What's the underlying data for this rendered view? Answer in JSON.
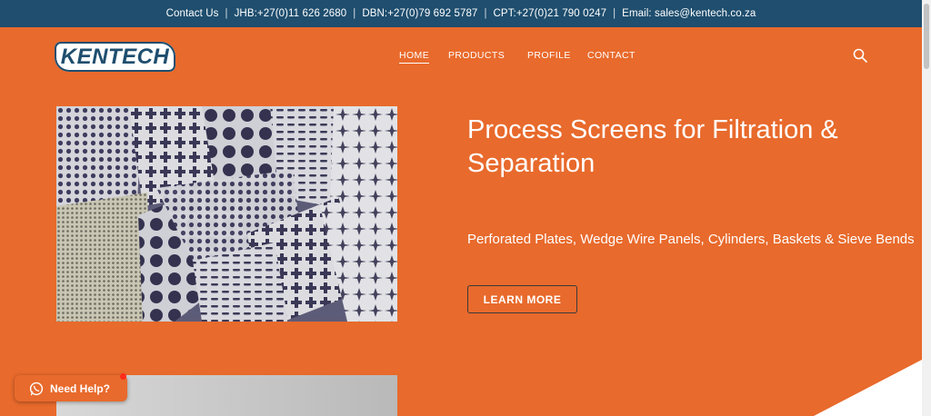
{
  "topbar": {
    "contact_us": "Contact Us",
    "jhb": "JHB:+27(0)11 626 2680",
    "dbn": "DBN:+27(0)79 692 5787",
    "cpt": "CPT:+27(0)21 790 0247",
    "email": "Email: sales@kentech.co.za",
    "separator": "|"
  },
  "logo": {
    "text": "KENTECH"
  },
  "nav": {
    "home": "HOME",
    "products": "PRODUCTS",
    "profile": "PROFILE",
    "contact": "CONTACT",
    "search_icon": "search-icon"
  },
  "hero": {
    "title": "Process Screens for Filtration & Separation",
    "subtitle": "Perforated Plates, Wedge Wire Panels, Cylinders, Baskets & Sieve Bends",
    "button": "LEARN MORE"
  },
  "help": {
    "label": "Need Help?",
    "icon": "whatsapp-icon"
  },
  "colors": {
    "topbar_bg": "#1f4e6e",
    "brand_orange": "#e86a2c",
    "logo_navy": "#1f4e6e",
    "notification_dot": "#ff2a1a"
  }
}
